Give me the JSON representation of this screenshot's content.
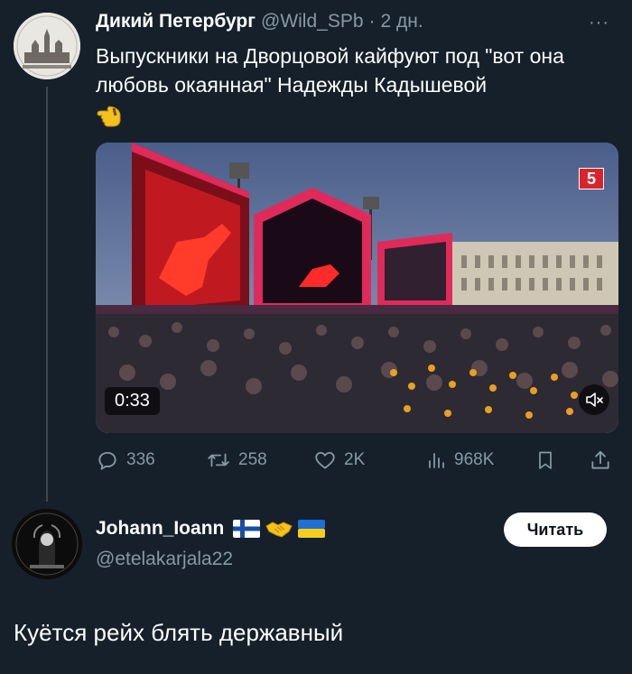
{
  "tweet": {
    "author_name": "Дикий Петербург",
    "handle": "@Wild_SPb",
    "separator": "·",
    "time": "2 дн.",
    "more_label": "···",
    "text": "Выпускники на Дворцовой кайфуют под \"вот она любовь окаянная\" Надежды Кадышевой"
  },
  "video": {
    "channel_badge": "5",
    "duration": "0:33",
    "muted": true
  },
  "actions": {
    "replies": "336",
    "retweets": "258",
    "likes": "2K",
    "views": "968K"
  },
  "reply_account": {
    "name": "Johann_Ioann",
    "handle": "@etelakarjala22",
    "follow_label": "Читать",
    "text": "Куётся рейх блять державный"
  },
  "colors": {
    "background": "#15202b",
    "secondary_text": "#8899a6",
    "thread_line": "#3a4651",
    "badge_red": "#d9252a"
  }
}
